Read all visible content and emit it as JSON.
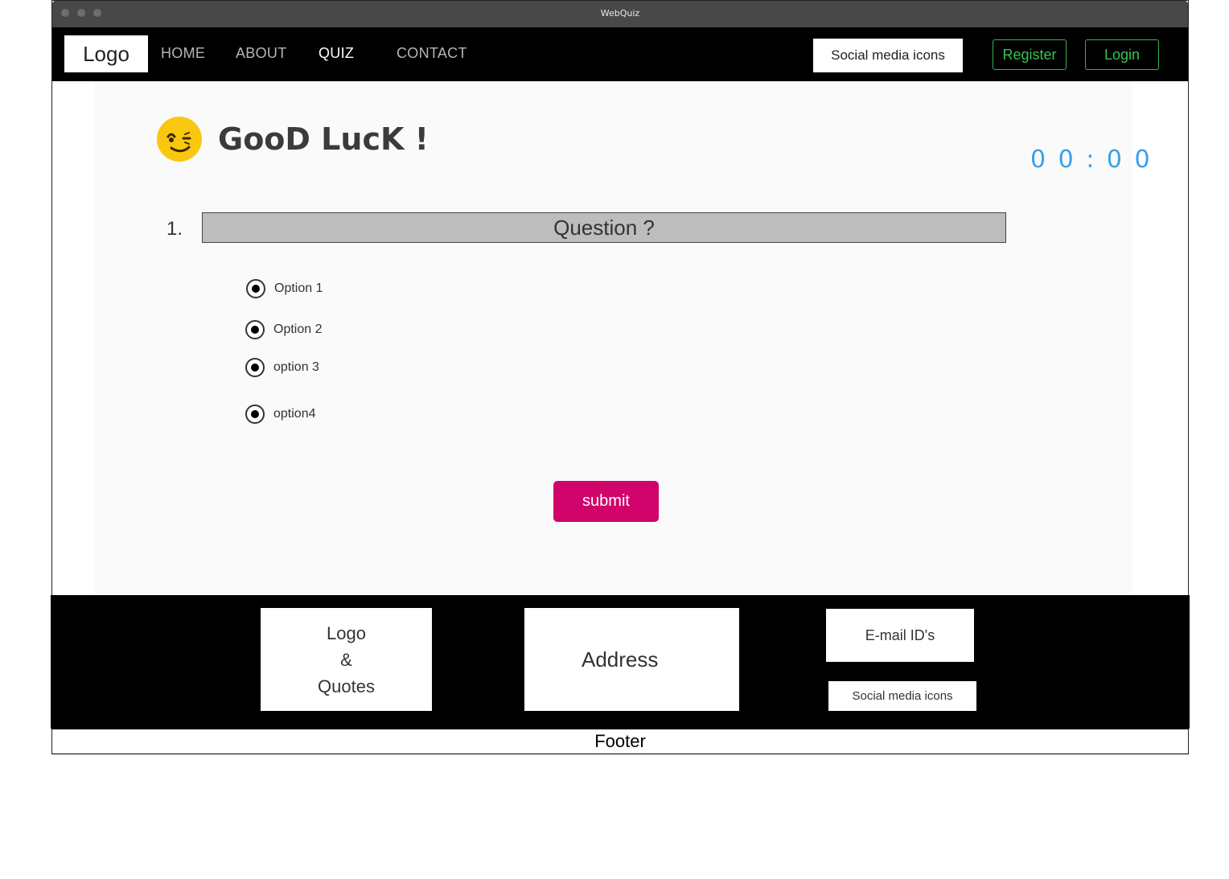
{
  "window": {
    "title": "WebQuiz"
  },
  "navbar": {
    "logo": "Logo",
    "links": [
      "HOME",
      "ABOUT",
      "QUIZ",
      "CONTACT"
    ],
    "active_link": "QUIZ",
    "social": "Social media icons",
    "register": "Register",
    "login": "Login"
  },
  "quiz": {
    "emoji_icon": "winking-face-icon",
    "heading": "GooD LucK !",
    "timer": "0 0 : 0 0",
    "question_number": "1.",
    "question": "Question ?",
    "options": [
      "Option 1",
      "Option 2",
      "option 3",
      "option4"
    ],
    "submit": "submit"
  },
  "footer": {
    "logo_quotes": [
      "Logo",
      "&",
      "Quotes"
    ],
    "address": "Address",
    "emails": "E-mail ID's",
    "social": "Social media icons",
    "label": "Footer"
  },
  "colors": {
    "accent_green": "#39c251",
    "submit_pink": "#d0046a",
    "timer_blue": "#3aa0e8",
    "emoji_yellow": "#f9c80e"
  }
}
